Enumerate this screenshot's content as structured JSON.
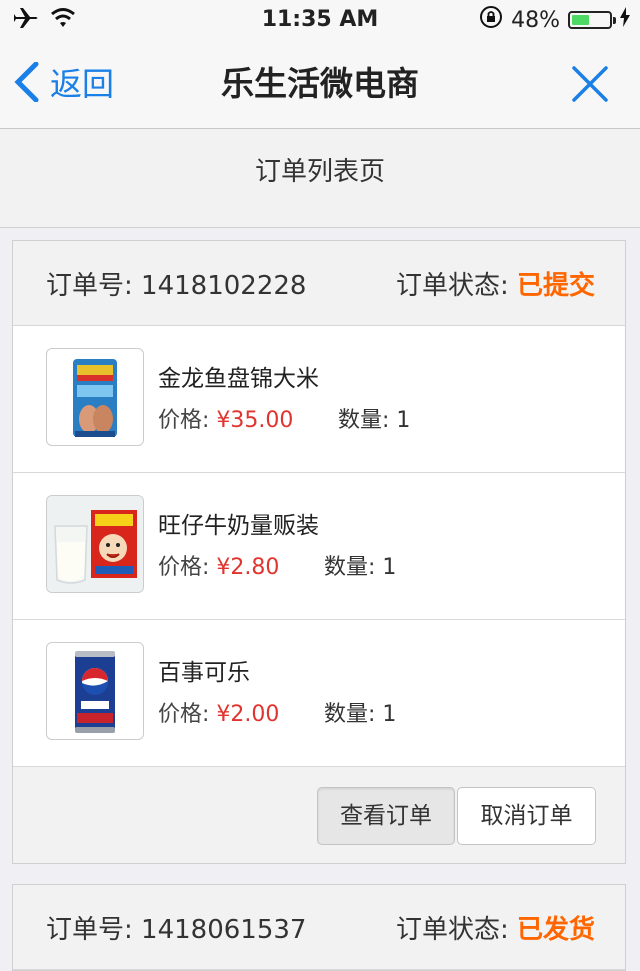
{
  "status_bar": {
    "time": "11:35 AM",
    "battery_text": "48%",
    "battery_level": 0.48,
    "icons": [
      "airplane-icon",
      "wifi-icon",
      "rotation-lock-icon",
      "battery-icon",
      "charging-icon"
    ]
  },
  "nav": {
    "back_label": "返回",
    "title": "乐生活微电商",
    "close_icon": "close-icon",
    "accent_color": "#1a7fe6"
  },
  "page": {
    "header": "订单列表页"
  },
  "labels": {
    "order_no": "订单号: ",
    "order_status": "订单状态: ",
    "price": "价格: ",
    "quantity": "数量: ",
    "view_order": "查看订单",
    "cancel_order": "取消订单"
  },
  "colors": {
    "status": "#ff6600",
    "price": "#e0342f"
  },
  "orders": [
    {
      "order_no": "1418102228",
      "status": "已提交",
      "items": [
        {
          "name": "金龙鱼盘锦大米",
          "price": "¥35.00",
          "quantity": "1",
          "image_icon": "rice-bag-image"
        },
        {
          "name": "旺仔牛奶量贩装",
          "price": "¥2.80",
          "quantity": "1",
          "image_icon": "milk-carton-image"
        },
        {
          "name": "百事可乐",
          "price": "¥2.00",
          "quantity": "1",
          "image_icon": "pepsi-can-image"
        }
      ]
    },
    {
      "order_no": "1418061537",
      "status": "已发货",
      "items": []
    }
  ]
}
